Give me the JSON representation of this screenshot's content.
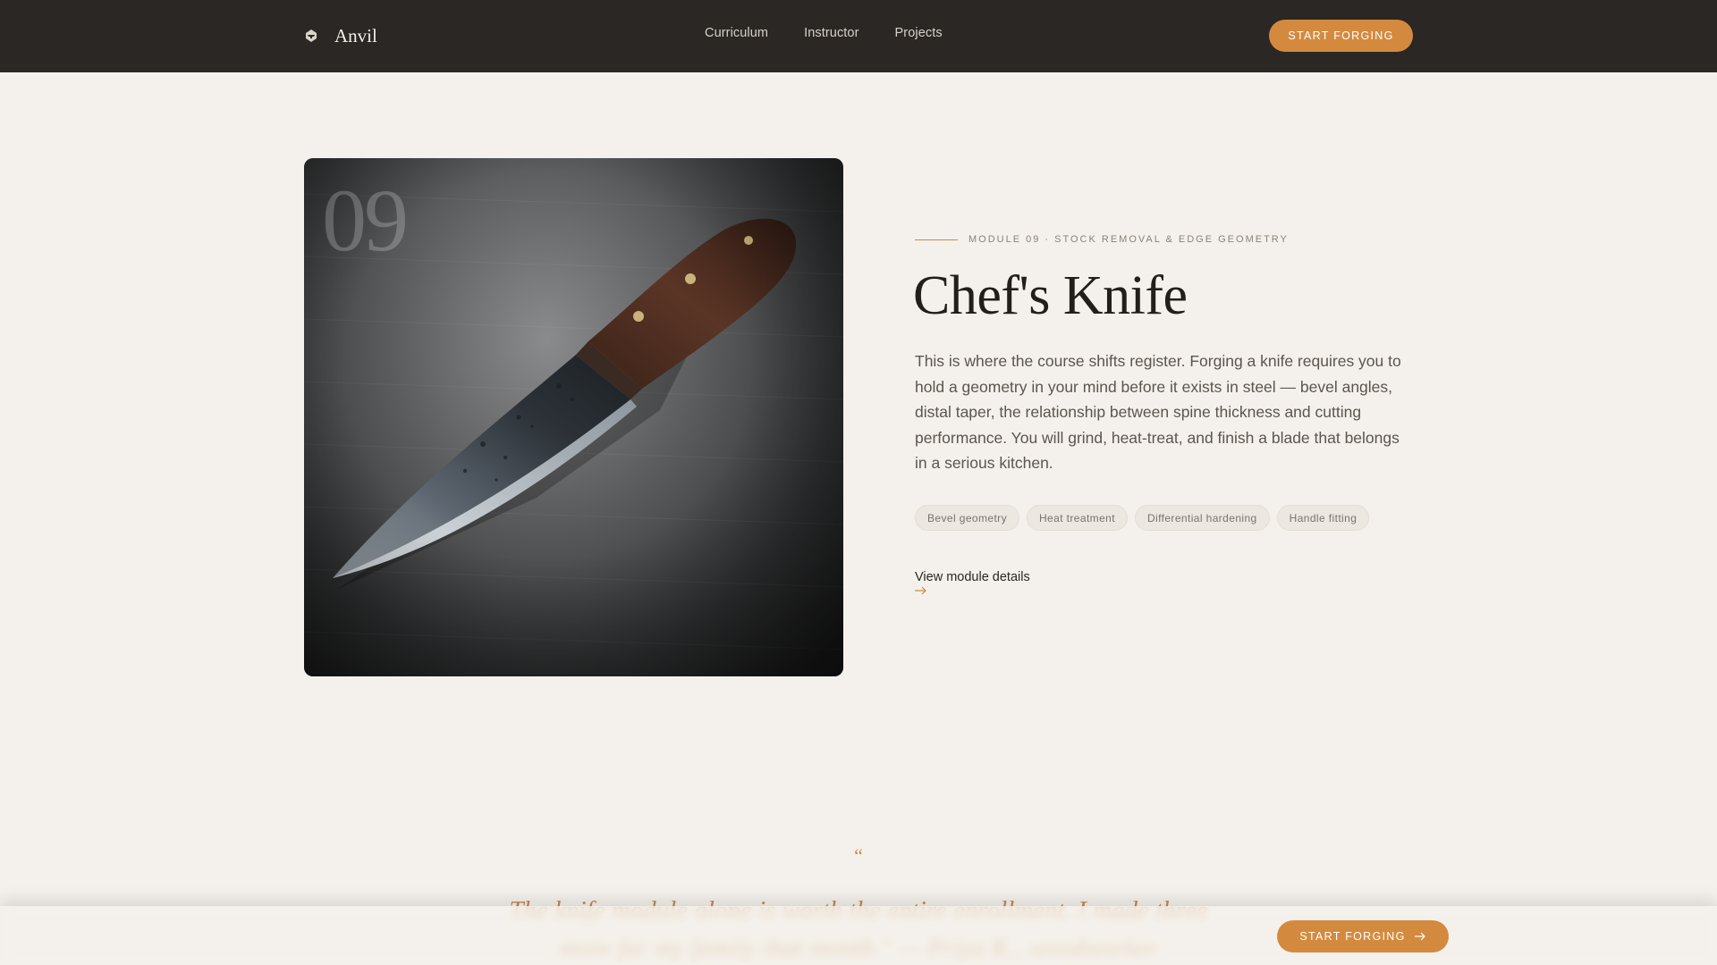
{
  "nav": {
    "brand": "Anvil",
    "links": [
      "Curriculum",
      "Instructor",
      "Projects"
    ],
    "cta_label": "START FORGING"
  },
  "module": {
    "number": "09",
    "eyebrow": "MODULE 09 · STOCK REMOVAL & EDGE GEOMETRY",
    "title": "Chef's Knife",
    "description": "This is where the course shifts register. Forging a knife requires you to hold a geometry in your mind before it exists in steel — bevel angles, distal taper, the relationship between spine thickness and cutting performance. You will grind, heat-treat, and finish a blade that belongs in a serious kitchen.",
    "tags": [
      "Bevel geometry",
      "Heat treatment",
      "Differential hardening",
      "Handle fitting"
    ],
    "link_label": "View module details"
  },
  "testimonial": {
    "mark": "“",
    "text": "The knife module alone is worth the entire enrollment. I made three more for my family that month.\" — Priya K., woodworker"
  },
  "sticky": {
    "cta_label": "START FORGING"
  },
  "colors": {
    "accent": "#d48a3e",
    "nav_bg": "#2a2724",
    "page_bg": "#f4f1ec"
  },
  "icons": {
    "brand": "anvil-logo-icon",
    "link_arrow": "arrow-right-icon",
    "cta_arrow": "arrow-right-icon"
  }
}
